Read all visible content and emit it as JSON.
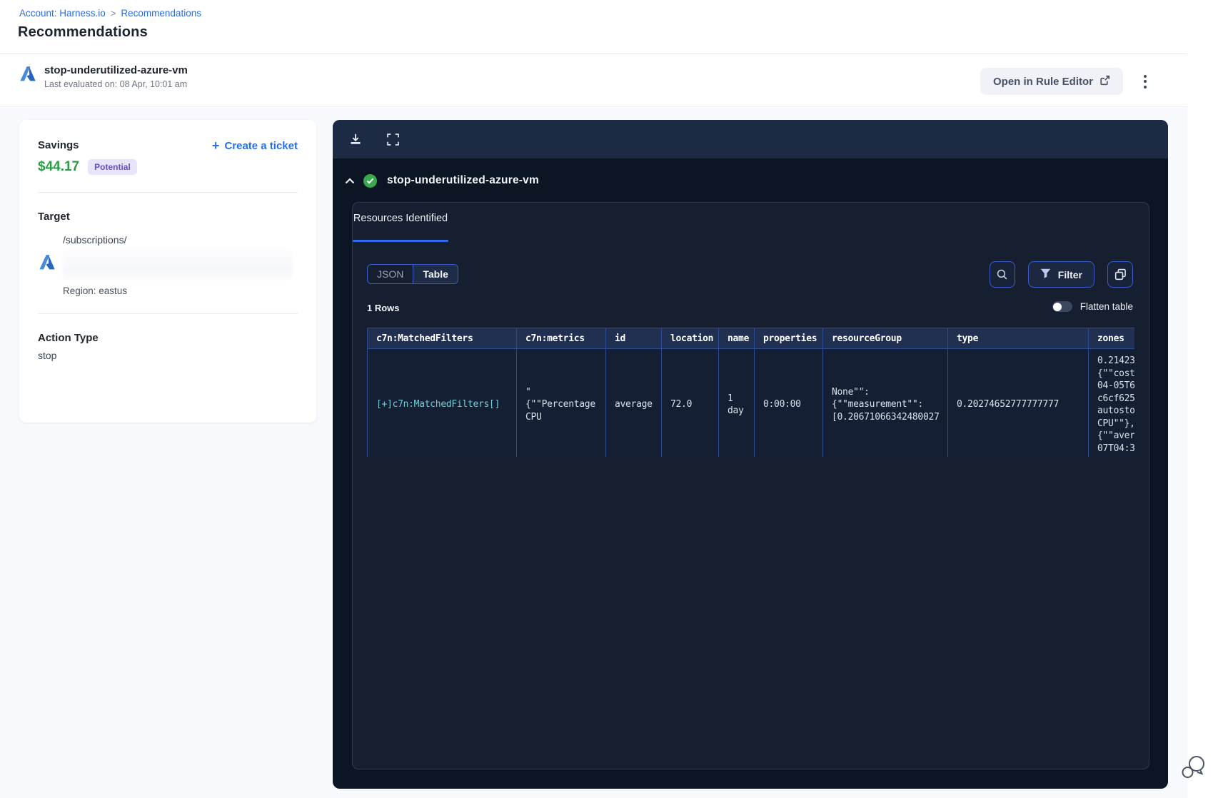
{
  "breadcrumb": {
    "account": "Account: Harness.io",
    "separator": ">",
    "current": "Recommendations"
  },
  "page": {
    "title": "Recommendations"
  },
  "header": {
    "rule_name": "stop-underutilized-azure-vm",
    "last_evaluated": "Last evaluated on: 08 Apr, 10:01 am",
    "open_rule_editor_label": "Open in Rule Editor"
  },
  "summary_card": {
    "savings_label": "Savings",
    "savings_value": "$44.17",
    "savings_badge": "Potential",
    "create_ticket_label": "Create a ticket",
    "target_label": "Target",
    "target_path": "/subscriptions/",
    "region": "Region: eastus",
    "action_type_label": "Action Type",
    "action_type_value": "stop"
  },
  "viewer": {
    "title": "stop-underutilized-azure-vm",
    "tab_label": "Resources Identified",
    "toggle_json": "JSON",
    "toggle_table": "Table",
    "filter_label": "Filter",
    "rows_count": "1 Rows",
    "flatten_label": "Flatten table",
    "table": {
      "columns": [
        "c7n:MatchedFilters",
        "c7n:metrics",
        "id",
        "location",
        "name",
        "properties",
        "resourceGroup",
        "type",
        "zones"
      ],
      "row": {
        "matched_filters": "[+]c7n:MatchedFilters[]",
        "metrics": "\"\n{\"\"Percentage\nCPU",
        "id": "average",
        "location": "72.0",
        "name": "1\nday",
        "properties": "0:00:00",
        "resource_group": "None\"\":\n{\"\"measurement\"\":\n[0.20671066342480027",
        "type": "0.20274652777777777",
        "zones": "0.21423\n{\"\"cost\n04-05T6\nc6cf625\nautosto\nCPU\"\"},\n{\"\"aver\n07T04:3"
      }
    }
  },
  "colors": {
    "accent_blue": "#2570e8",
    "savings_green": "#2b9e44",
    "badge_purple_bg": "#e8e4fa",
    "badge_purple_text": "#6152c8",
    "panel_bg": "#0c1524",
    "panel_toolbar": "#1d2a43",
    "table_border": "#2c4c92",
    "teal_link": "#76ccd9",
    "success_green": "#3aa94e"
  }
}
